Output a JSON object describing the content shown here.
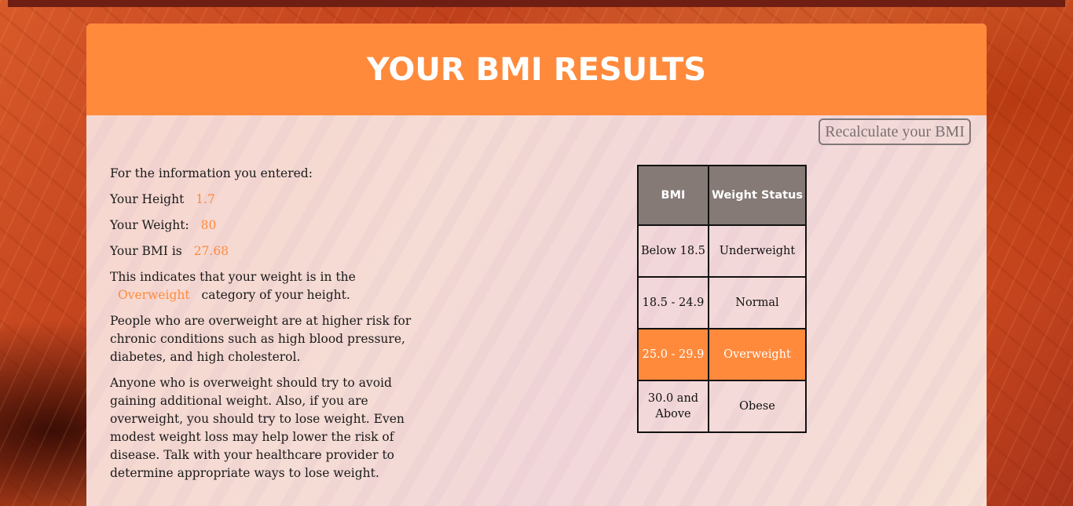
{
  "header": {
    "title": "YOUR BMI RESULTS"
  },
  "actions": {
    "recalculate_label": "Recalculate your BMI"
  },
  "info": {
    "intro": "For the information you entered:",
    "height_label": "Your Height",
    "height_value": "1.7",
    "weight_label": "Your Weight:",
    "weight_value": "80",
    "bmi_label": "Your BMI is",
    "bmi_value": "27.68",
    "category_prefix": "This indicates that your weight is in the",
    "category_value": "Overweight",
    "category_suffix": "category of your height.",
    "risk_text": "People who are overweight are at higher risk for chronic conditions such as high blood pressure, diabetes, and high cholesterol.",
    "advice_text": "Anyone who is overweight should try to avoid gaining additional weight. Also, if you are overweight, you should try to lose weight. Even modest weight loss may help lower the risk of disease. Talk with your healthcare provider to determine appropriate ways to lose weight."
  },
  "table": {
    "headers": [
      "BMI",
      "Weight Status"
    ],
    "rows": [
      {
        "bmi": "Below 18.5",
        "status": "Underweight"
      },
      {
        "bmi": "18.5 - 24.9",
        "status": "Normal"
      },
      {
        "bmi": "25.0 - 29.9",
        "status": "Overweight"
      },
      {
        "bmi": "30.0 and Above",
        "status": "Obese"
      }
    ]
  },
  "colors": {
    "accent": "#ff8a3c",
    "table_header": "#857a76",
    "text": "#1a1a1a"
  }
}
